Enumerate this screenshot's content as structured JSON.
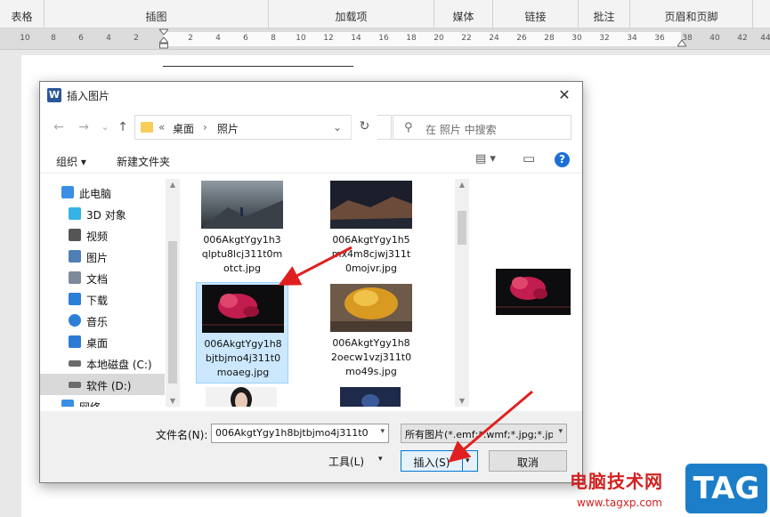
{
  "ribbon": {
    "groups": [
      "表格",
      "插图",
      "加载项",
      "媒体",
      "链接",
      "批注",
      "页眉和页脚"
    ]
  },
  "ruler": {
    "left_numbers": [
      "10",
      "8",
      "6",
      "4",
      "2"
    ],
    "right_numbers": [
      "2",
      "4",
      "6",
      "8",
      "10",
      "12",
      "14",
      "16",
      "18",
      "20",
      "22",
      "24",
      "26",
      "28",
      "30",
      "32",
      "34",
      "36",
      "38",
      "40",
      "42",
      "44"
    ]
  },
  "dialog": {
    "title": "插入图片",
    "close_glyph": "✕",
    "nav": {
      "back_glyph": "←",
      "forward_glyph": "→",
      "recent_glyph": "⌄",
      "up_glyph": "↑",
      "breadcrumb_prefix": "«",
      "breadcrumb": [
        "桌面",
        "照片"
      ],
      "separator_glyph": "›",
      "dropdown_glyph": "⌄",
      "refresh_glyph": "↻",
      "search_placeholder": "在 照片 中搜索"
    },
    "toolbar": {
      "organize": "组织 ▾",
      "new_folder": "新建文件夹",
      "view_glyph": "▤ ▾",
      "pane_glyph": "▭",
      "help_glyph": "?"
    },
    "sidebar": {
      "items": [
        {
          "label": "此电脑",
          "icon": "computer-icon",
          "color": "#3a8ee6"
        },
        {
          "label": "3D 对象",
          "icon": "cube-icon",
          "color": "#35b3e6"
        },
        {
          "label": "视频",
          "icon": "video-icon",
          "color": "#555555"
        },
        {
          "label": "图片",
          "icon": "picture-icon",
          "color": "#4f7fb5"
        },
        {
          "label": "文档",
          "icon": "document-icon",
          "color": "#7d8a99"
        },
        {
          "label": "下载",
          "icon": "download-icon",
          "color": "#2c7fd6"
        },
        {
          "label": "音乐",
          "icon": "music-icon",
          "color": "#2c7fd6"
        },
        {
          "label": "桌面",
          "icon": "desktop-icon",
          "color": "#2a7bd4"
        },
        {
          "label": "本地磁盘 (C:)",
          "icon": "drive-icon",
          "color": "#6b6b6b"
        },
        {
          "label": "软件 (D:)",
          "icon": "drive-icon",
          "color": "#6b6b6b"
        },
        {
          "label": "网络",
          "icon": "network-icon",
          "color": "#3a8ee6"
        }
      ],
      "selected_index": 9
    },
    "files": [
      {
        "name": "006AkgtYgy1h3qlptu8lcj311t0motct.jpg",
        "lines": [
          "006AkgtYgy1h3",
          "qlptu8lcj311t0m",
          "otct.jpg"
        ]
      },
      {
        "name": "006AkgtYgy1h5mx4m8cjwj311t0mojvr.jpg",
        "lines": [
          "006AkgtYgy1h5",
          "mx4m8cjwj311t",
          "0mojvr.jpg"
        ]
      },
      {
        "name": "006AkgtYgy1h8bjtbjmo4j311t0moaeg.jpg",
        "lines": [
          "006AkgtYgy1h8",
          "bjtbjmo4j311t0",
          "moaeg.jpg"
        ]
      },
      {
        "name": "006AkgtYgy1h82oecw1vzj311t0mo49s.jpg",
        "lines": [
          "006AkgtYgy1h8",
          "2oecw1vzj311t0",
          "mo49s.jpg"
        ]
      }
    ],
    "selected_file_index": 2,
    "bottom": {
      "filename_label": "文件名(N):",
      "filename_value": "006AkgtYgy1h8bjtbjmo4j311t0",
      "filetype_value": "所有图片(*.emf;*.wmf;*.jpg;*.jp",
      "tools_label": "工具(L)",
      "insert_label": "插入(S)",
      "cancel_label": "取消",
      "dropdown_glyph": "▾"
    }
  },
  "watermark": {
    "site_name": "电脑技术网",
    "url": "www.tagxp.com",
    "tag": "TAG"
  },
  "colors": {
    "selection": "#cce8ff",
    "accent": "#0078d7",
    "arrow": "#e02020"
  }
}
